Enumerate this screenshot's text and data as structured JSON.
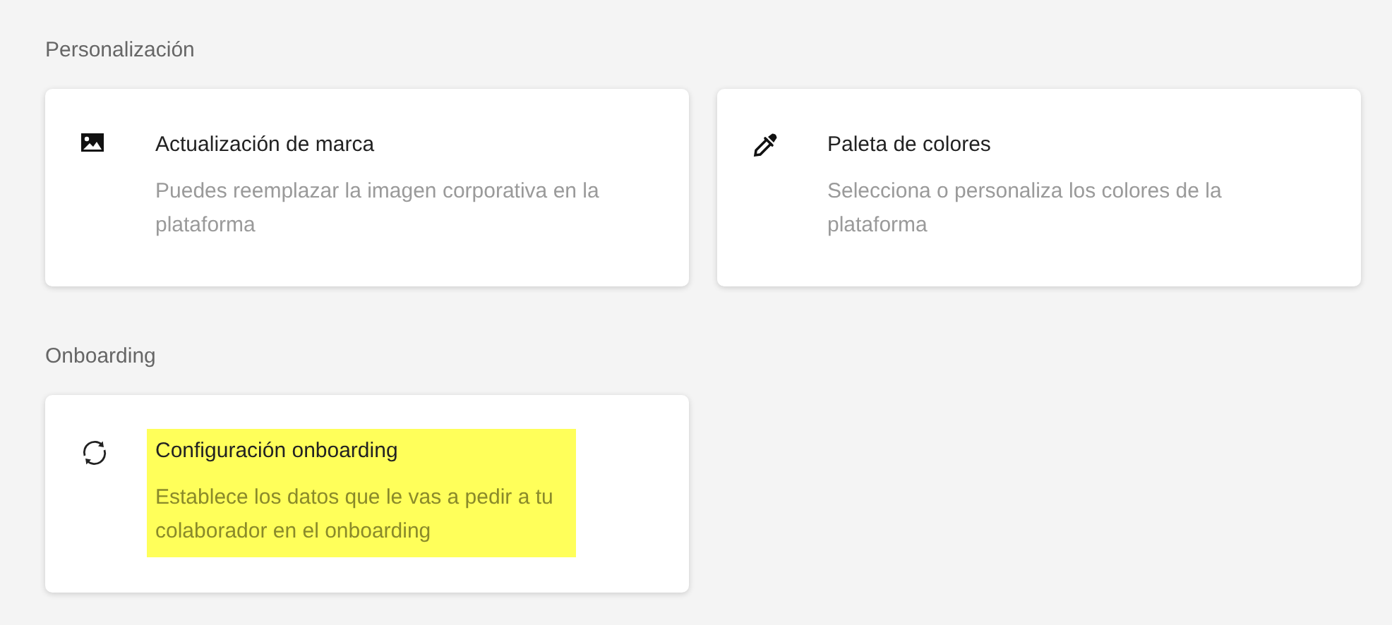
{
  "sections": [
    {
      "title": "Personalización",
      "cards": [
        {
          "kind": "image",
          "title": "Actualización de marca",
          "description": "Puedes reemplazar la imagen corporativa en la plataforma",
          "highlighted": false
        },
        {
          "kind": "dropper",
          "title": "Paleta de colores",
          "description": "Selecciona o personaliza los colores de la plataforma",
          "highlighted": false
        }
      ]
    },
    {
      "title": "Onboarding",
      "cards": [
        {
          "kind": "sync",
          "title": "Configuración onboarding",
          "description": "Establece los datos que le vas a pedir a tu colaborador en el onboarding",
          "highlighted": true
        }
      ]
    }
  ]
}
